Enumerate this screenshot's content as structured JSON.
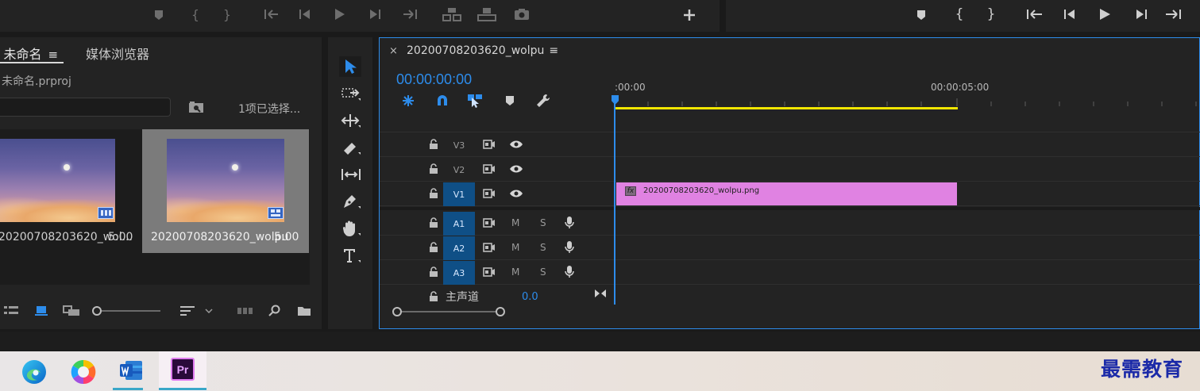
{
  "project_panel": {
    "tab_project": "未命名",
    "tab_media_browser": "媒体浏览器",
    "file_name": "未命名.prproj",
    "selection_status": "1项已选择...",
    "items": [
      {
        "name": "20200708203620_wol...",
        "duration": "5:00"
      },
      {
        "name": "20200708203620_wolpu",
        "duration": "5:00"
      }
    ]
  },
  "timeline": {
    "sequence_name": "20200708203620_wolpu",
    "timecode": "00:00:00:00",
    "ruler_labels": [
      ":00:00",
      "00:00:05:00"
    ],
    "video_tracks": [
      "V3",
      "V2",
      "V1"
    ],
    "audio_tracks": [
      "A1",
      "A2",
      "A3"
    ],
    "mute_label": "M",
    "solo_label": "S",
    "master_label": "主声道",
    "master_value": "0.0",
    "clip_name": "20200708203620_wolpu.png",
    "clip_fx": "fx"
  },
  "watermark": "最需教育",
  "colors": {
    "accent_blue": "#2d8ceb",
    "clip_pink": "#e082e2",
    "work_area_yellow": "#f0e600",
    "track_active": "#0f4f86"
  }
}
